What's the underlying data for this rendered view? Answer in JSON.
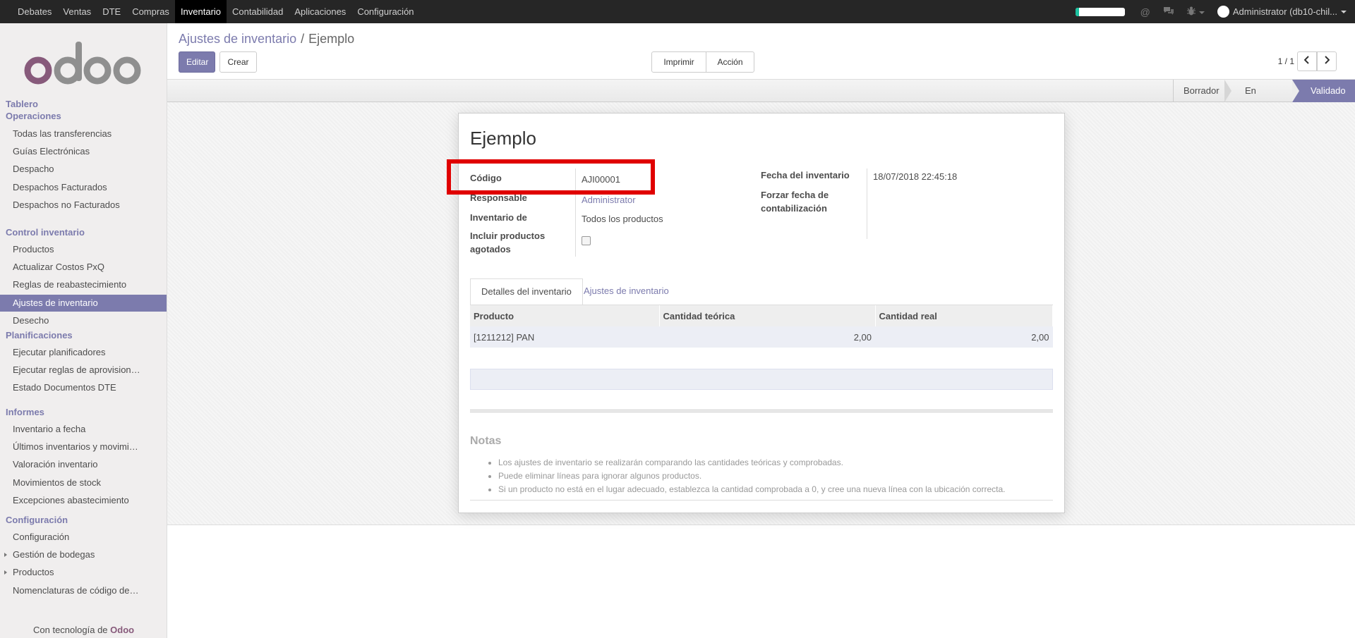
{
  "topbar": {
    "menu": [
      "Debates",
      "Ventas",
      "DTE",
      "Compras",
      "Inventario",
      "Contabilidad",
      "Aplicaciones",
      "Configuración"
    ],
    "active_menu": "Inventario",
    "progress_percent": 8,
    "user": "Administrator (db10-chil..."
  },
  "sidebar": {
    "logo_text": "odoo",
    "dashboard": "Tablero",
    "sections": [
      {
        "title": "Operaciones",
        "items": [
          "Todas las transferencias",
          "Guías Electrónicas",
          "Despacho",
          "Despachos Facturados",
          "Despachos no Facturados"
        ]
      },
      {
        "title": "Control inventario",
        "items": [
          "Productos",
          "Actualizar Costos PxQ",
          "Reglas de reabastecimiento",
          "Ajustes de inventario",
          "Desecho"
        ]
      },
      {
        "title": "Planificaciones",
        "items": [
          "Ejecutar planificadores",
          "Ejecutar reglas de aprovision…",
          "Estado Documentos DTE"
        ]
      },
      {
        "title": "Informes",
        "items": [
          "Inventario a fecha",
          "Últimos inventarios y movimi…",
          "Valoración inventario",
          "Movimientos de stock",
          "Excepciones abastecimiento"
        ]
      },
      {
        "title": "Configuración",
        "items": [
          "Configuración",
          "Gestión de bodegas",
          "Productos",
          "Nomenclaturas de código de…"
        ]
      }
    ],
    "active_item": "Ajustes de inventario",
    "powered_prefix": "Con tecnología de",
    "powered_brand": "Odoo"
  },
  "control_panel": {
    "breadcrumb_parent": "Ajustes de inventario",
    "breadcrumb_separator": "/",
    "breadcrumb_current": "Ejemplo",
    "edit_label": "Editar",
    "create_label": "Crear",
    "print_label": "Imprimir",
    "action_label": "Acción",
    "pager": "1 / 1"
  },
  "statusbar": {
    "stages": [
      "Borrador",
      "En proceso",
      "Validado"
    ],
    "current": "Validado"
  },
  "form": {
    "title": "Ejemplo",
    "fields": {
      "codigo_label": "Código",
      "codigo_value": "AJI00001",
      "responsable_label": "Responsable",
      "responsable_value": "Administrator",
      "inventario_de_label": "Inventario de",
      "inventario_de_value": "Todos los productos",
      "incluir_label_1": "Incluir productos",
      "incluir_label_2": "agotados",
      "incluir_checked": false,
      "fecha_label": "Fecha del inventario",
      "fecha_value": "18/07/2018 22:45:18",
      "forzar_label_1": "Forzar fecha de",
      "forzar_label_2": "contabilización"
    },
    "tabs": [
      "Detalles del inventario",
      "Ajustes de inventario"
    ],
    "active_tab": 0,
    "table": {
      "columns": [
        "Producto",
        "Cantidad teórica",
        "Cantidad real"
      ],
      "rows": [
        [
          "[1211212] PAN",
          "2,00",
          "2,00"
        ]
      ]
    },
    "notes_title": "Notas",
    "notes": [
      "Los ajustes de inventario se realizarán comparando las cantidades teóricas y comprobadas.",
      "Puede eliminar líneas para ignorar algunos productos.",
      "Si un producto no está en el lugar adecuado, establezca la cantidad comprobada a 0, y cree una nueva línea con la ubicación correcta."
    ]
  },
  "colors": {
    "accent": "#7c7bad",
    "topbar": "#262626",
    "highlight": "#e00000",
    "brand": "#875a7b"
  }
}
